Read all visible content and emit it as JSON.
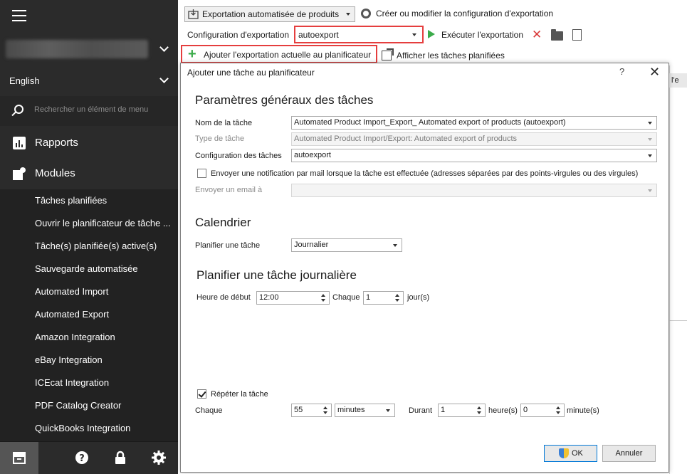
{
  "sidebar": {
    "language": "English",
    "search_placeholder": "Rechercher un élément de menu",
    "reports_label": "Rapports",
    "modules_label": "Modules",
    "items": [
      "Tâches planifiées",
      "Ouvrir le planificateur de tâche ...",
      "Tâche(s) planifiée(s) active(s)",
      "Sauvegarde automatisée",
      "Automated Import",
      "Automated Export",
      "Amazon Integration",
      "eBay Integration",
      "ICEcat Integration",
      "PDF Catalog Creator",
      "QuickBooks Integration"
    ]
  },
  "toolbar": {
    "export_mode": "Exportation automatisée de produits",
    "create_config_label": "Créer ou modifier la configuration d'exportation",
    "config_label": "Configuration d'exportation",
    "config_value": "autoexport",
    "run_label": "Exécuter l'exportation",
    "add_to_scheduler_label": "Ajouter l'exportation actuelle au planificateur",
    "show_scheduled_label": "Afficher les tâches planifiées"
  },
  "background": {
    "tab_fragment": "l'e"
  },
  "dialog": {
    "title": "Ajouter une tâche au planificateur",
    "help": "?",
    "close": "✕",
    "general": {
      "heading": "Paramètres généraux des tâches",
      "task_name_label": "Nom de la tâche",
      "task_name_value": "Automated Product Import_Export_ Automated export of products (autoexport)",
      "task_type_label": "Type de tâche",
      "task_type_value": "Automated Product Import/Export: Automated export of products",
      "task_config_label": "Configuration des tâches",
      "task_config_value": "autoexport",
      "notify_label": "Envoyer une notification par mail lorsque la tâche est effectuée (adresses séparées par des points-virgules ou des virgules)",
      "notify_checked": false,
      "email_label": "Envoyer un email à",
      "email_value": ""
    },
    "calendar": {
      "heading": "Calendrier",
      "schedule_label": "Planifier une tâche",
      "schedule_value": "Journalier"
    },
    "daily": {
      "heading": "Planifier une tâche journalière",
      "start_label": "Heure de début",
      "start_value": "12:00",
      "every_label": "Chaque",
      "every_value": "1",
      "unit_label": "jour(s)"
    },
    "repeat": {
      "label": "Répéter la tâche",
      "checked": true,
      "every_label": "Chaque",
      "every_value": "55",
      "every_unit": "minutes",
      "duration_label": "Durant",
      "hours_value": "1",
      "hours_label": "heure(s)",
      "minutes_value": "0",
      "minutes_label": "minute(s)"
    },
    "ok_label": "OK",
    "cancel_label": "Annuler"
  },
  "colors": {
    "sidebar_bg": "#2b2b2b",
    "highlight_red": "#e53e3e",
    "run_green": "#3bab4a",
    "primary_blue": "#0078d7"
  }
}
